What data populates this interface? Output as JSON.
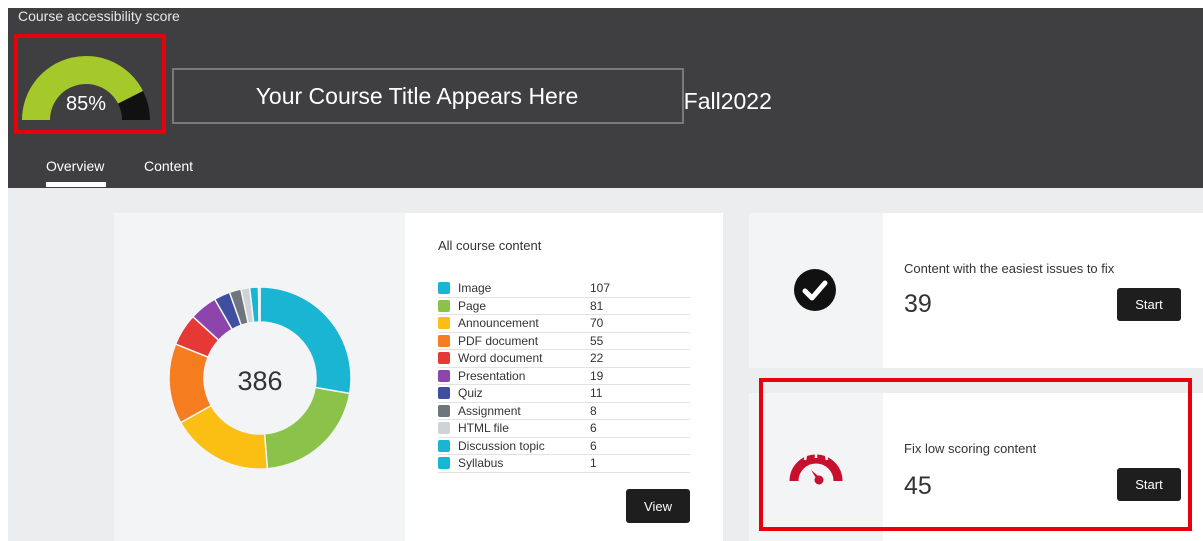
{
  "header": {
    "score_label": "Course accessibility score",
    "score_value": 85,
    "score_text": "85%",
    "course_title": "Your Course Title Appears Here",
    "title_suffix": "-Fall2022",
    "tabs": [
      {
        "label": "Overview",
        "active": true
      },
      {
        "label": "Content",
        "active": false
      }
    ]
  },
  "content_summary": {
    "total": "386",
    "list_title": "All course content",
    "items": [
      {
        "label": "Image",
        "count": "107",
        "color": "#1bb5d4"
      },
      {
        "label": "Page",
        "count": "81",
        "color": "#8bc34a"
      },
      {
        "label": "Announcement",
        "count": "70",
        "color": "#fbbf13"
      },
      {
        "label": "PDF document",
        "count": "55",
        "color": "#f57c1f"
      },
      {
        "label": "Word document",
        "count": "22",
        "color": "#e53935"
      },
      {
        "label": "Presentation",
        "count": "19",
        "color": "#8e44ad"
      },
      {
        "label": "Quiz",
        "count": "11",
        "color": "#3f4ea0"
      },
      {
        "label": "Assignment",
        "count": "8",
        "color": "#6d767c"
      },
      {
        "label": "HTML file",
        "count": "6",
        "color": "#d0d3d5"
      },
      {
        "label": "Discussion topic",
        "count": "6",
        "color": "#1bb5d4"
      },
      {
        "label": "Syllabus",
        "count": "1",
        "color": "#1bb5d4"
      }
    ],
    "view_label": "View"
  },
  "easy_fix": {
    "title": "Content with the easiest issues to fix",
    "count": "39",
    "start_label": "Start"
  },
  "low_score": {
    "title": "Fix low scoring content",
    "count": "45",
    "start_label": "Start"
  },
  "colors": {
    "header_bg": "#3f3f42",
    "gauge_good": "#a5c82a",
    "gauge_rest": "#111111",
    "highlight": "#e8000b",
    "speedometer": "#c8102e"
  }
}
